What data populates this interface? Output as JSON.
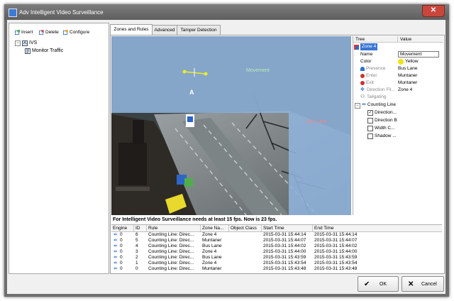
{
  "window": {
    "title": "Adv Intelligent Video Surveillance",
    "close_label": "✕"
  },
  "toolbar": {
    "insert_label": "Insert",
    "delete_label": "Delete",
    "configure_label": "Configure"
  },
  "tree": {
    "root_label": "IVS",
    "child_label": "Monitor Traffic"
  },
  "tabs": [
    {
      "label": "Zones and Rules",
      "active": true
    },
    {
      "label": "Advanced",
      "active": false
    },
    {
      "label": "Tamper Detection",
      "active": false
    }
  ],
  "video": {
    "zone_labels": [
      "Movement",
      "Bus Lane"
    ],
    "line_marker": "A",
    "colors": {
      "blue_zone": "#8fb3dc",
      "yellow_line": "#ecec2a"
    }
  },
  "properties": {
    "header_tree": "Tree",
    "header_value": "Value",
    "selected_node": "Zone 4",
    "rows": [
      {
        "name": "Name",
        "value": "Movement",
        "icon": "none",
        "muted": false
      },
      {
        "name": "Color",
        "value": "Yellow",
        "icon": "none",
        "muted": false,
        "swatch": "#f2e218"
      },
      {
        "name": "Presence",
        "value": "Bus Lane",
        "icon": "person-icon",
        "muted": true
      },
      {
        "name": "Enter",
        "value": "Muntaner",
        "icon": "enter-icon",
        "muted": true
      },
      {
        "name": "Exit",
        "value": "Muntaner",
        "icon": "exit-icon",
        "muted": true
      },
      {
        "name": "Direction Fil...",
        "value": "Zone 4",
        "icon": "direction-icon",
        "muted": true
      },
      {
        "name": "Tailgating",
        "value": "",
        "icon": "tailgating-icon",
        "muted": true
      }
    ],
    "counting_line_label": "Counting Line",
    "counting_children": [
      {
        "label": "Direction...",
        "checked": true
      },
      {
        "label": "Direction B",
        "checked": false
      },
      {
        "label": "Width C...",
        "checked": false
      },
      {
        "label": "Shadow ...",
        "checked": false
      }
    ]
  },
  "status_text": "For Intelligent Video Surveillance needs at least 15 fps. Now is 23 fps.",
  "events": {
    "columns": [
      "Engine",
      "ID",
      "Rule",
      "Zone Na...",
      "Object Class",
      "Start Time",
      "End Time"
    ],
    "rows": [
      {
        "engine": "0",
        "id": "6",
        "rule": "Counting Line: Direc...",
        "zone": "Zone 4",
        "object_class": "",
        "start": "2015-03-31 15:44:14",
        "end": "2015-03-31 15:44:14"
      },
      {
        "engine": "0",
        "id": "5",
        "rule": "Counting Line: Direc...",
        "zone": "Muntaner",
        "object_class": "",
        "start": "2015-03-31 15:44:07",
        "end": "2015-03-31 15:44:07"
      },
      {
        "engine": "0",
        "id": "4",
        "rule": "Counting Line: Direc...",
        "zone": "Bus Lane",
        "object_class": "",
        "start": "2015-03-31 15:44:02",
        "end": "2015-03-31 15:44:02"
      },
      {
        "engine": "0",
        "id": "3",
        "rule": "Counting Line: Direc...",
        "zone": "Zone 4",
        "object_class": "",
        "start": "2015-03-31 15:44:00",
        "end": "2015-03-31 15:44:00"
      },
      {
        "engine": "0",
        "id": "2",
        "rule": "Counting Line: Direc...",
        "zone": "Bus Lane",
        "object_class": "",
        "start": "2015-03-31 15:43:59",
        "end": "2015-03-31 15:43:59"
      },
      {
        "engine": "0",
        "id": "1",
        "rule": "Counting Line: Direc...",
        "zone": "Zone 4",
        "object_class": "",
        "start": "2015-03-31 15:43:54",
        "end": "2015-03-31 15:43:54"
      },
      {
        "engine": "0",
        "id": "0",
        "rule": "Counting Line: Direc...",
        "zone": "Muntaner",
        "object_class": "",
        "start": "2015-03-31 15:43:48",
        "end": "2015-03-31 15:43:48"
      }
    ]
  },
  "buttons": {
    "ok_label": "OK",
    "cancel_label": "Cancel"
  }
}
